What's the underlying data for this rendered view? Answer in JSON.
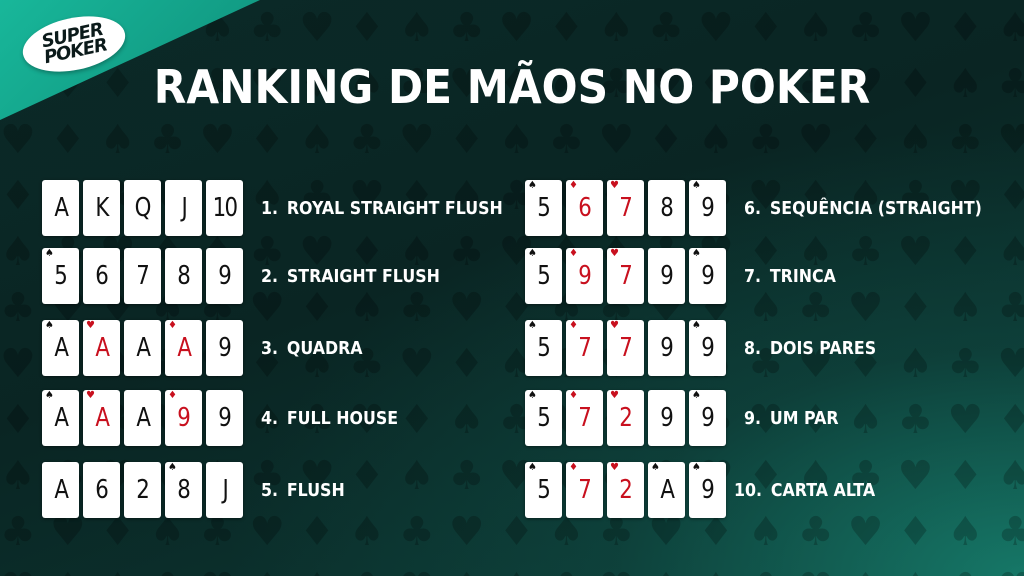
{
  "brand": {
    "line1": "SUPER",
    "line2": "POKER"
  },
  "title": "RANKING DE MÃOS NO POKER",
  "colors": {
    "accent": "#18b79a",
    "red_suit": "#c8101e",
    "background": "#0b2a28"
  },
  "hands": [
    {
      "number": "1.",
      "name": "ROYAL STRAIGHT FLUSH",
      "cards": [
        {
          "value": "A",
          "suit": "",
          "red": false
        },
        {
          "value": "K",
          "suit": "",
          "red": false
        },
        {
          "value": "Q",
          "suit": "",
          "red": false
        },
        {
          "value": "J",
          "suit": "",
          "red": false
        },
        {
          "value": "10",
          "suit": "",
          "red": false
        }
      ]
    },
    {
      "number": "2.",
      "name": "STRAIGHT FLUSH",
      "cards": [
        {
          "value": "5",
          "suit": "♠",
          "red": false
        },
        {
          "value": "6",
          "suit": "",
          "red": false
        },
        {
          "value": "7",
          "suit": "",
          "red": false
        },
        {
          "value": "8",
          "suit": "",
          "red": false
        },
        {
          "value": "9",
          "suit": "",
          "red": false
        }
      ]
    },
    {
      "number": "3.",
      "name": "QUADRA",
      "cards": [
        {
          "value": "A",
          "suit": "♠",
          "red": false
        },
        {
          "value": "A",
          "suit": "♥",
          "red": true
        },
        {
          "value": "A",
          "suit": "",
          "red": false
        },
        {
          "value": "A",
          "suit": "♦",
          "red": true
        },
        {
          "value": "9",
          "suit": "",
          "red": false
        }
      ]
    },
    {
      "number": "4.",
      "name": "FULL HOUSE",
      "cards": [
        {
          "value": "A",
          "suit": "♠",
          "red": false
        },
        {
          "value": "A",
          "suit": "♥",
          "red": true
        },
        {
          "value": "A",
          "suit": "",
          "red": false
        },
        {
          "value": "9",
          "suit": "♦",
          "red": true
        },
        {
          "value": "9",
          "suit": "",
          "red": false
        }
      ]
    },
    {
      "number": "5.",
      "name": "FLUSH",
      "cards": [
        {
          "value": "A",
          "suit": "",
          "red": false
        },
        {
          "value": "6",
          "suit": "",
          "red": false
        },
        {
          "value": "2",
          "suit": "",
          "red": false
        },
        {
          "value": "8",
          "suit": "♠",
          "red": false
        },
        {
          "value": "J",
          "suit": "",
          "red": false
        }
      ]
    },
    {
      "number": "6.",
      "name": "SEQUÊNCIA (STRAIGHT)",
      "cards": [
        {
          "value": "5",
          "suit": "♠",
          "red": false
        },
        {
          "value": "6",
          "suit": "♦",
          "red": true
        },
        {
          "value": "7",
          "suit": "♥",
          "red": true
        },
        {
          "value": "8",
          "suit": "",
          "red": false
        },
        {
          "value": "9",
          "suit": "♠",
          "red": false
        }
      ]
    },
    {
      "number": "7.",
      "name": "TRINCA",
      "cards": [
        {
          "value": "5",
          "suit": "♠",
          "red": false
        },
        {
          "value": "9",
          "suit": "♦",
          "red": true
        },
        {
          "value": "7",
          "suit": "♥",
          "red": true
        },
        {
          "value": "9",
          "suit": "",
          "red": false
        },
        {
          "value": "9",
          "suit": "♠",
          "red": false
        }
      ]
    },
    {
      "number": "8.",
      "name": "DOIS PARES",
      "cards": [
        {
          "value": "5",
          "suit": "♠",
          "red": false
        },
        {
          "value": "7",
          "suit": "♦",
          "red": true
        },
        {
          "value": "7",
          "suit": "♥",
          "red": true
        },
        {
          "value": "9",
          "suit": "",
          "red": false
        },
        {
          "value": "9",
          "suit": "♠",
          "red": false
        }
      ]
    },
    {
      "number": "9.",
      "name": "UM PAR",
      "cards": [
        {
          "value": "5",
          "suit": "♠",
          "red": false
        },
        {
          "value": "7",
          "suit": "♦",
          "red": true
        },
        {
          "value": "2",
          "suit": "♥",
          "red": true
        },
        {
          "value": "9",
          "suit": "",
          "red": false
        },
        {
          "value": "9",
          "suit": "♠",
          "red": false
        }
      ]
    },
    {
      "number": "10.",
      "name": "CARTA ALTA",
      "cards": [
        {
          "value": "5",
          "suit": "♠",
          "red": false
        },
        {
          "value": "7",
          "suit": "♦",
          "red": true
        },
        {
          "value": "2",
          "suit": "♥",
          "red": true
        },
        {
          "value": "A",
          "suit": "♠",
          "red": false
        },
        {
          "value": "9",
          "suit": "♠",
          "red": false
        }
      ]
    }
  ]
}
